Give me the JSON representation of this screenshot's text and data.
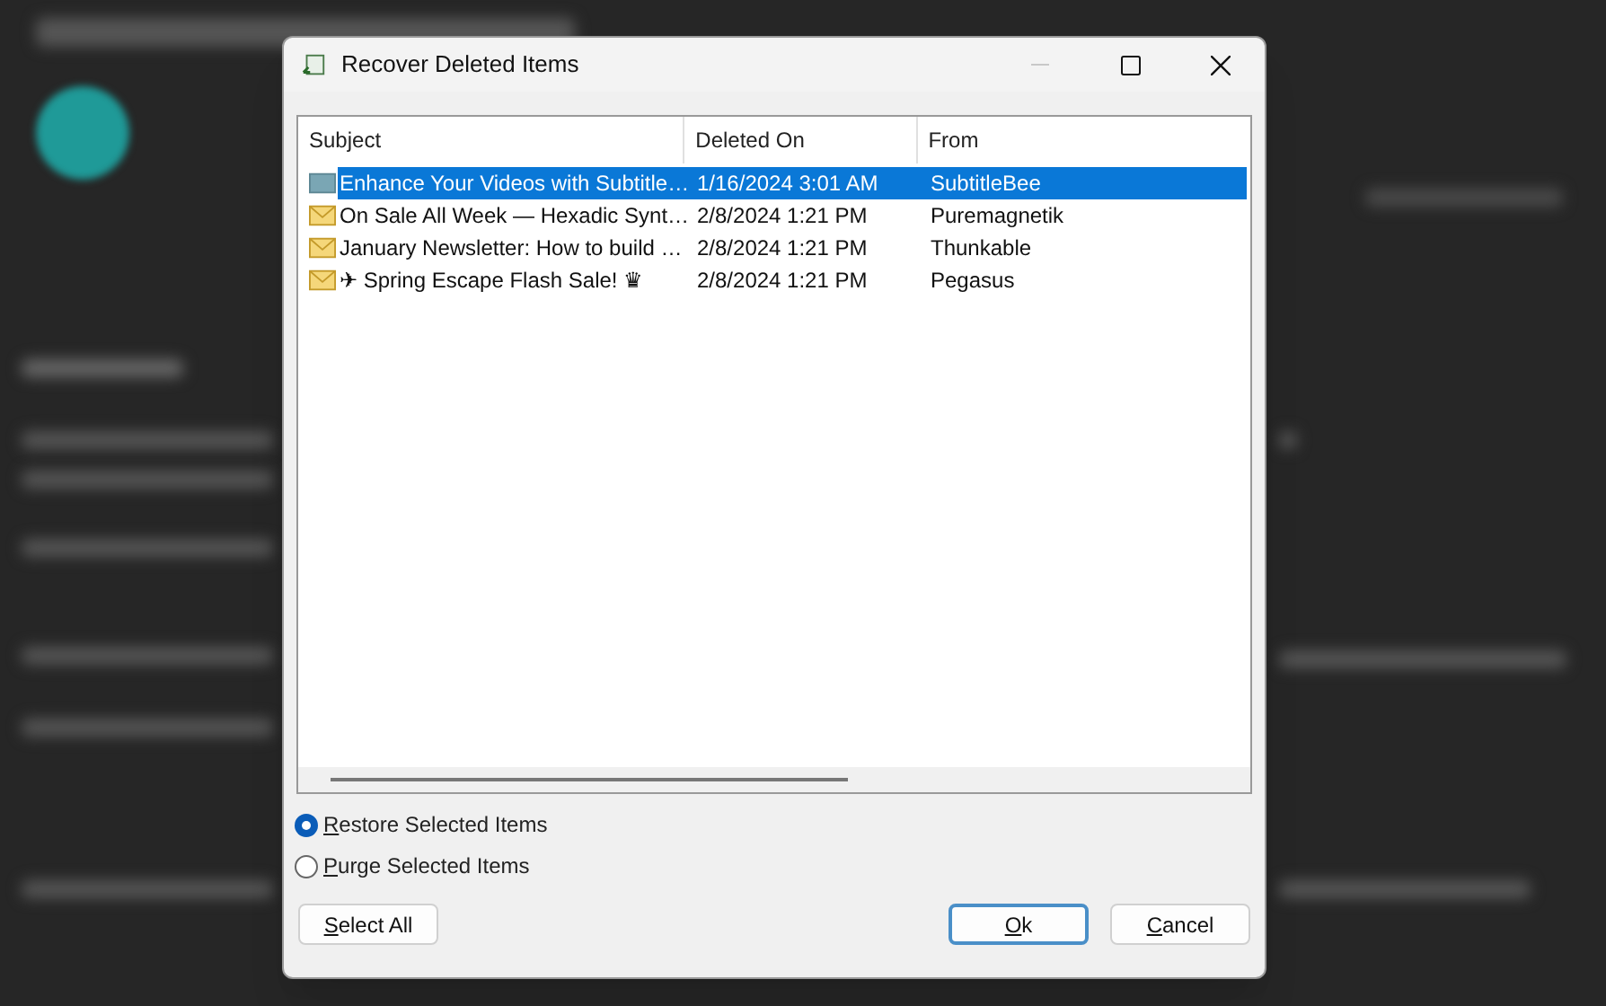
{
  "window": {
    "title": "Recover Deleted Items",
    "minimize_disabled": true
  },
  "table": {
    "columns": [
      "Subject",
      "Deleted On",
      "From"
    ],
    "rows": [
      {
        "kind": "item",
        "subject": "Enhance Your Videos with Subtitle…",
        "deleted_on": "1/16/2024 3:01 AM",
        "from": "SubtitleBee",
        "selected": true
      },
      {
        "kind": "mail",
        "subject": "On Sale All Week — Hexadic Synt…",
        "deleted_on": "2/8/2024 1:21 PM",
        "from": "Puremagnetik",
        "selected": false
      },
      {
        "kind": "mail",
        "subject": "January Newsletter: How to build …",
        "deleted_on": "2/8/2024 1:21 PM",
        "from": "Thunkable",
        "selected": false
      },
      {
        "kind": "mail",
        "subject": "✈ Spring Escape Flash Sale! ♛",
        "deleted_on": "2/8/2024 1:21 PM",
        "from": "Pegasus",
        "selected": false
      }
    ]
  },
  "options": [
    {
      "label": "Restore Selected Items",
      "selected": true
    },
    {
      "label": "Purge Selected Items",
      "selected": false
    }
  ],
  "buttons": [
    {
      "label": "Select All",
      "default": false
    },
    {
      "label": "Ok",
      "default": true
    },
    {
      "label": "Cancel",
      "default": false
    }
  ]
}
